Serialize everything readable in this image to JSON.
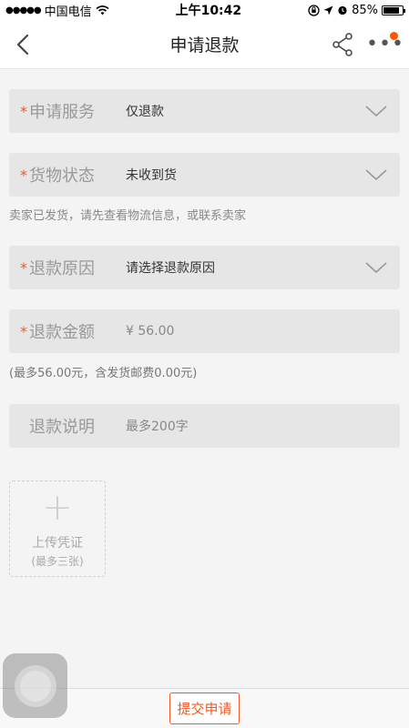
{
  "status_bar": {
    "signal": "●●●●●",
    "carrier": "中国电信",
    "time": "上午10:42",
    "battery": "85%"
  },
  "nav": {
    "title": "申请退款"
  },
  "form": {
    "service": {
      "label": "申请服务",
      "value": "仅退款"
    },
    "goods_status": {
      "label": "货物状态",
      "value": "未收到货",
      "hint": "卖家已发货，请先查看物流信息，或联系卖家"
    },
    "reason": {
      "label": "退款原因",
      "value": "请选择退款原因"
    },
    "amount": {
      "label": "退款金额",
      "value": "¥ 56.00",
      "hint": "(最多56.00元，含发货邮费0.00元)"
    },
    "description": {
      "label": "退款说明",
      "placeholder": "最多200字"
    }
  },
  "upload": {
    "plus": "+",
    "label": "上传凭证",
    "sub": "(最多三张)"
  },
  "bottom": {
    "submit": "提交申请"
  },
  "required_mark": "*",
  "colors": {
    "accent": "#f05a28",
    "badge": "#ff5500"
  }
}
